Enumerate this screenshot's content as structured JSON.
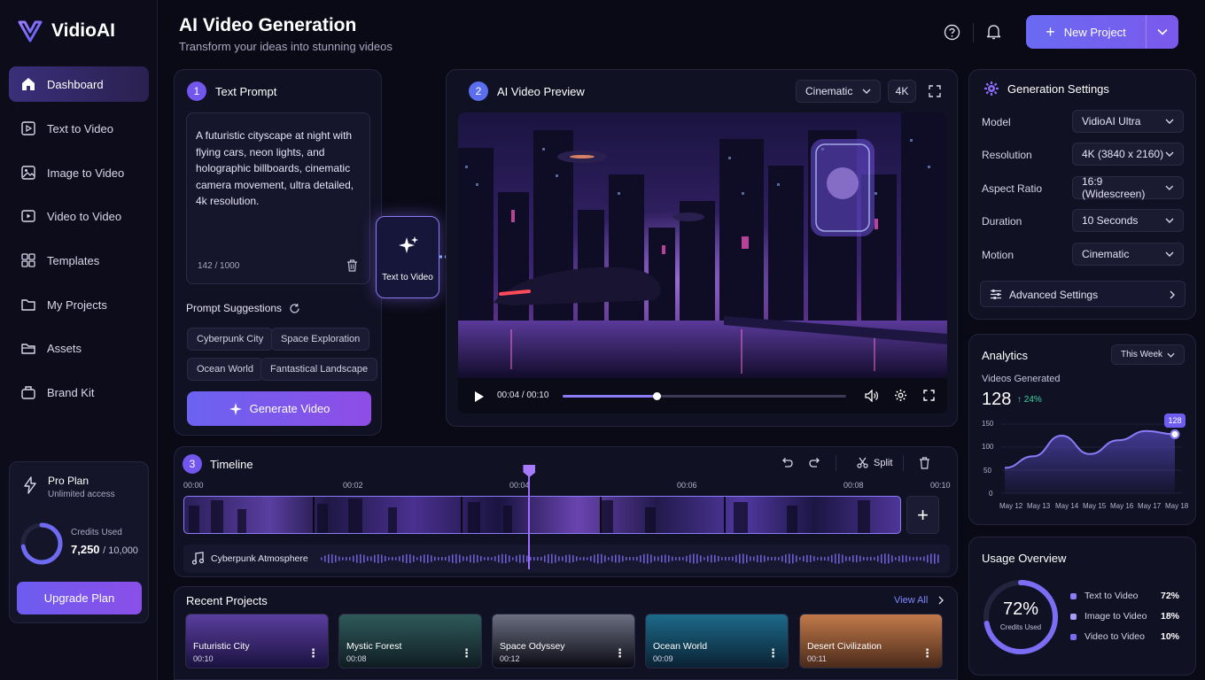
{
  "app": {
    "name": "VidioAI"
  },
  "sidebar": {
    "items": [
      {
        "label": "Dashboard",
        "icon": "home-icon"
      },
      {
        "label": "Text to Video",
        "icon": "text-video-icon"
      },
      {
        "label": "Image to Video",
        "icon": "image-icon"
      },
      {
        "label": "Video to Video",
        "icon": "video-icon"
      },
      {
        "label": "Templates",
        "icon": "templates-icon"
      },
      {
        "label": "My Projects",
        "icon": "folder-icon"
      },
      {
        "label": "Assets",
        "icon": "assets-icon"
      },
      {
        "label": "Brand Kit",
        "icon": "brand-kit-icon"
      }
    ],
    "plan": {
      "title": "Pro Plan",
      "subtitle": "Unlimited access",
      "credits_label": "Credits Used",
      "credits_used": "7,250",
      "credits_total": "/ 10,000",
      "credits_fraction": 0.725,
      "upgrade_label": "Upgrade Plan"
    }
  },
  "header": {
    "title": "AI Video Generation",
    "subtitle": "Transform your ideas into stunning videos",
    "new_project_label": "New Project"
  },
  "prompt": {
    "step": "1",
    "title": "Text Prompt",
    "text": "A futuristic cityscape at night with flying cars, neon lights, and holographic billboards, cinematic camera movement, ultra detailed, 4k resolution.",
    "char_count": "142 / 1000",
    "suggestions_label": "Prompt Suggestions",
    "suggestions": [
      "Cyberpunk City",
      "Space Exploration",
      "Ocean World",
      "Fantastical Landscape"
    ],
    "generate_label": "Generate Video"
  },
  "connector": {
    "label": "Text to Video"
  },
  "preview": {
    "step": "2",
    "title": "AI Video Preview",
    "style_select": "Cinematic",
    "quality_badge": "4K",
    "current_time": "00:04",
    "separator": "/",
    "total_time": "00:10",
    "progress_fraction": 0.33
  },
  "settings": {
    "title": "Generation Settings",
    "rows": [
      {
        "label": "Model",
        "value": "VidioAI Ultra"
      },
      {
        "label": "Resolution",
        "value": "4K (3840 x 2160)"
      },
      {
        "label": "Aspect Ratio",
        "value": "16:9 (Widescreen)"
      },
      {
        "label": "Duration",
        "value": "10 Seconds"
      },
      {
        "label": "Motion",
        "value": "Cinematic"
      }
    ],
    "advanced_label": "Advanced Settings"
  },
  "analytics": {
    "title": "Analytics",
    "range": "This Week",
    "metric_label": "Videos Generated",
    "metric_value": "128",
    "change": "↑ 24%",
    "chart_data": {
      "type": "area",
      "categories": [
        "May 12",
        "May 13",
        "May 14",
        "May 15",
        "May 16",
        "May 17",
        "May 18"
      ],
      "values": [
        55,
        80,
        125,
        85,
        115,
        135,
        128
      ],
      "y_ticks": [
        "0",
        "50",
        "100",
        "150"
      ],
      "ylim": [
        0,
        150
      ],
      "last_label": "128"
    }
  },
  "timeline": {
    "step": "3",
    "title": "Timeline",
    "split_label": "Split",
    "ticks": [
      "00:00",
      "00:02",
      "00:04",
      "00:06",
      "00:08",
      "00:10"
    ],
    "playhead_fraction": 0.4,
    "audio_label": "Cyberpunk Atmosphere"
  },
  "recent": {
    "title": "Recent Projects",
    "view_all": "View All",
    "items": [
      {
        "name": "Futuristic City",
        "duration": "00:10",
        "color_a": "#5a3e9e",
        "color_b": "#1a1240"
      },
      {
        "name": "Mystic Forest",
        "duration": "00:08",
        "color_a": "#2f5a5a",
        "color_b": "#0f1c22"
      },
      {
        "name": "Space Odyssey",
        "duration": "00:12",
        "color_a": "#6b6f80",
        "color_b": "#0a0a14"
      },
      {
        "name": "Ocean World",
        "duration": "00:09",
        "color_a": "#1d6a8a",
        "color_b": "#0a2233"
      },
      {
        "name": "Desert Civilization",
        "duration": "00:11",
        "color_a": "#c27a4a",
        "color_b": "#4a2a1a"
      }
    ]
  },
  "usage": {
    "title": "Usage Overview",
    "percent": "72%",
    "percent_label": "Credits Used",
    "fraction": 0.72,
    "items": [
      {
        "label": "Text to Video",
        "value": "72%",
        "color": "#8b7cf6"
      },
      {
        "label": "Image to Video",
        "value": "18%",
        "color": "#a79cf9"
      },
      {
        "label": "Video to Video",
        "value": "10%",
        "color": "#7a6cf0"
      }
    ]
  }
}
